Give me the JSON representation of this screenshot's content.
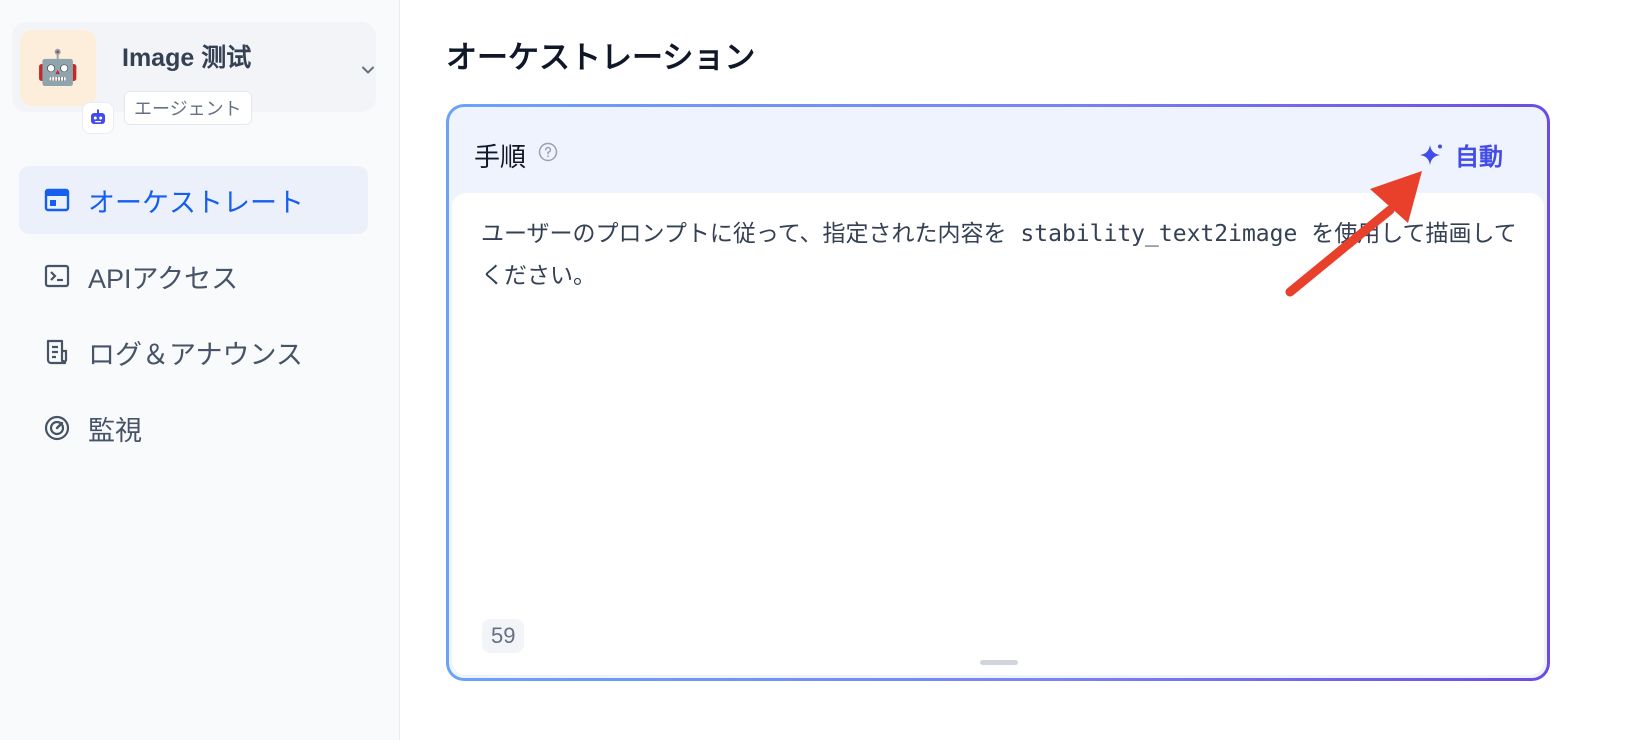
{
  "app": {
    "name": "Image 测试",
    "type_badge": "エージェント",
    "icon": "robot-emoji",
    "badge_icon": "agent-icon"
  },
  "sidebar": {
    "items": [
      {
        "label": "オーケストレート",
        "icon": "layout-icon",
        "active": true
      },
      {
        "label": "APIアクセス",
        "icon": "terminal-icon",
        "active": false
      },
      {
        "label": "ログ＆アナウンス",
        "icon": "file-list-icon",
        "active": false
      },
      {
        "label": "監視",
        "icon": "dashboard-icon",
        "active": false
      }
    ]
  },
  "main": {
    "title": "オーケストレーション",
    "prompt": {
      "label": "手順",
      "auto_label": "自動",
      "text": "ユーザーのプロンプトに従って、指定された内容を stability_text2image を使用して描画してください。",
      "char_count": "59"
    }
  },
  "colors": {
    "accent": "#155eef",
    "auto_button": "#444ce7",
    "annotation_arrow": "#e8402a"
  }
}
